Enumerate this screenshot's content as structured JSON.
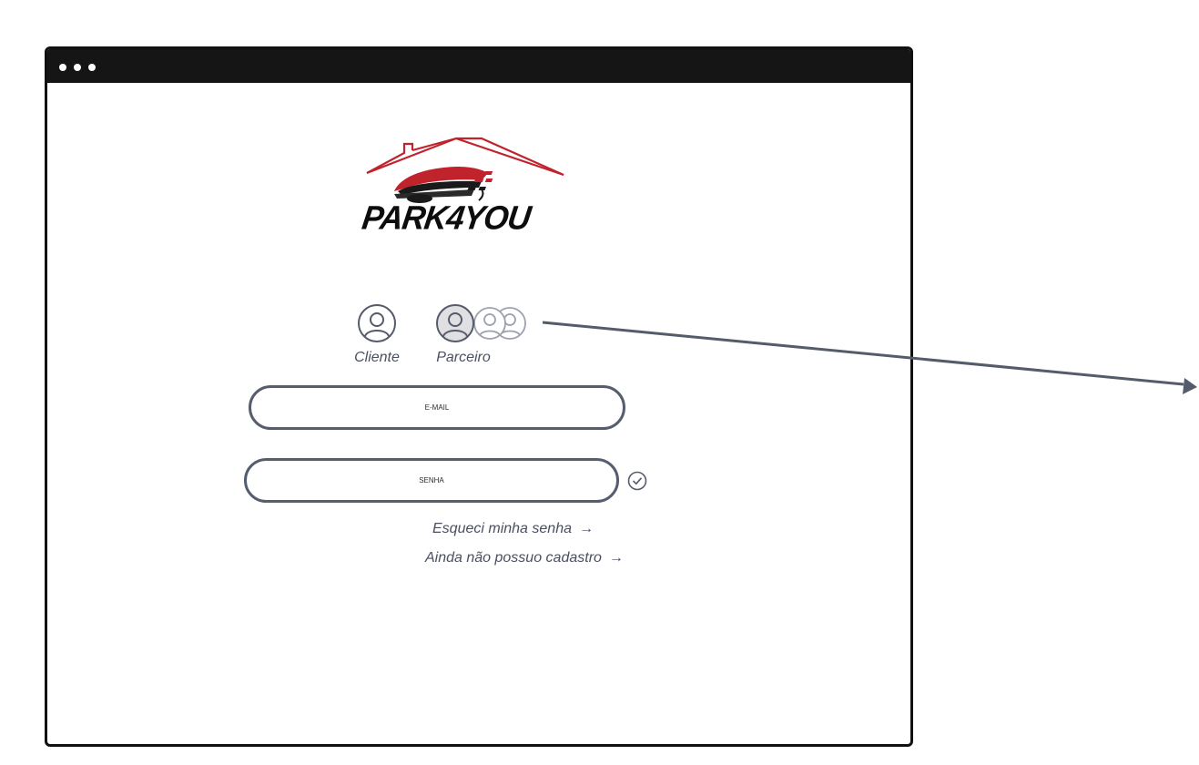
{
  "app": {
    "brand_name": "PARK4YOU"
  },
  "user_types": {
    "client_label": "Cliente",
    "partner_label": "Parceiro"
  },
  "form": {
    "email_placeholder": "E-MAIL",
    "password_placeholder": "SENHA"
  },
  "links": {
    "forgot_password": "Esqueci minha senha",
    "no_account": "Ainda não possuo cadastro",
    "arrow": "→"
  },
  "colors": {
    "accent": "#c0232b",
    "outline": "#565d6e",
    "text": "#4b5061"
  }
}
